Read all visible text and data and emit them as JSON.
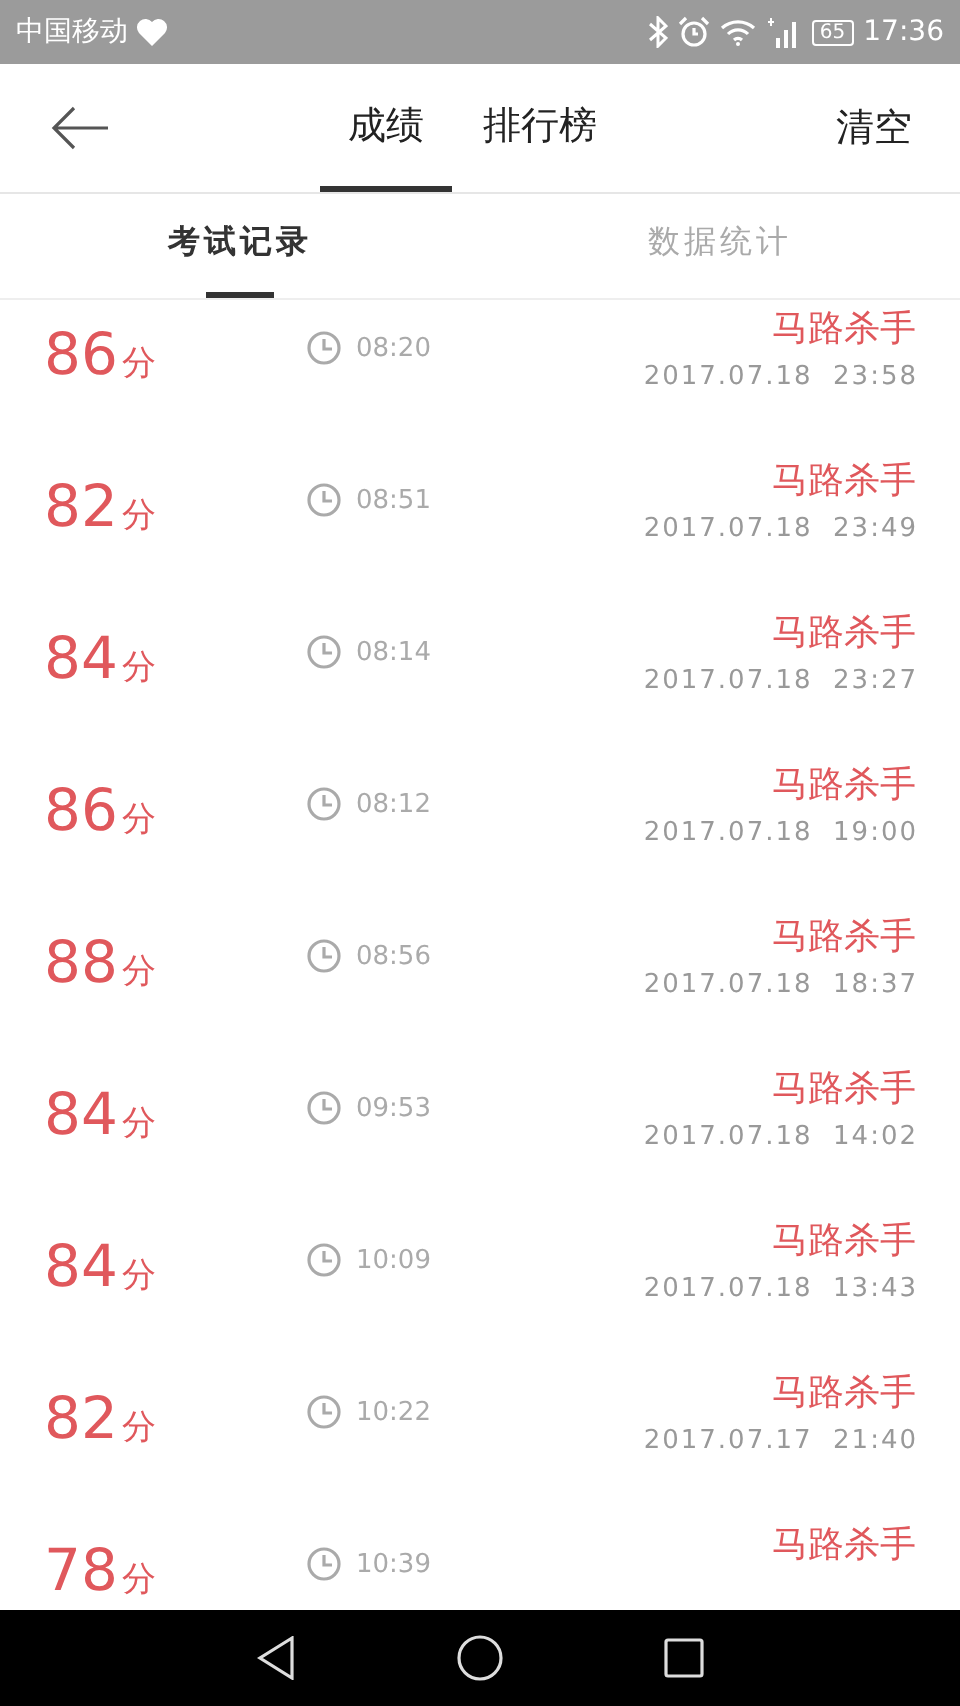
{
  "status_bar": {
    "carrier": "中国移动",
    "battery": "65",
    "time": "17:36"
  },
  "header": {
    "tabs": [
      {
        "label": "成绩",
        "selected": true
      },
      {
        "label": "排行榜",
        "selected": false
      }
    ],
    "action": "清空"
  },
  "sub_tabs": [
    {
      "label": "考试记录",
      "selected": true
    },
    {
      "label": "数据统计",
      "selected": false
    }
  ],
  "records": [
    {
      "score": "86",
      "unit": "分",
      "duration": "08:20",
      "name": "马路杀手",
      "date": "2017.07.18  23:58"
    },
    {
      "score": "82",
      "unit": "分",
      "duration": "08:51",
      "name": "马路杀手",
      "date": "2017.07.18  23:49"
    },
    {
      "score": "84",
      "unit": "分",
      "duration": "08:14",
      "name": "马路杀手",
      "date": "2017.07.18  23:27"
    },
    {
      "score": "86",
      "unit": "分",
      "duration": "08:12",
      "name": "马路杀手",
      "date": "2017.07.18  19:00"
    },
    {
      "score": "88",
      "unit": "分",
      "duration": "08:56",
      "name": "马路杀手",
      "date": "2017.07.18  18:37"
    },
    {
      "score": "84",
      "unit": "分",
      "duration": "09:53",
      "name": "马路杀手",
      "date": "2017.07.18  14:02"
    },
    {
      "score": "84",
      "unit": "分",
      "duration": "10:09",
      "name": "马路杀手",
      "date": "2017.07.18  13:43"
    },
    {
      "score": "82",
      "unit": "分",
      "duration": "10:22",
      "name": "马路杀手",
      "date": "2017.07.17  21:40"
    },
    {
      "score": "78",
      "unit": "分",
      "duration": "10:39",
      "name": "马路杀手"
    }
  ]
}
